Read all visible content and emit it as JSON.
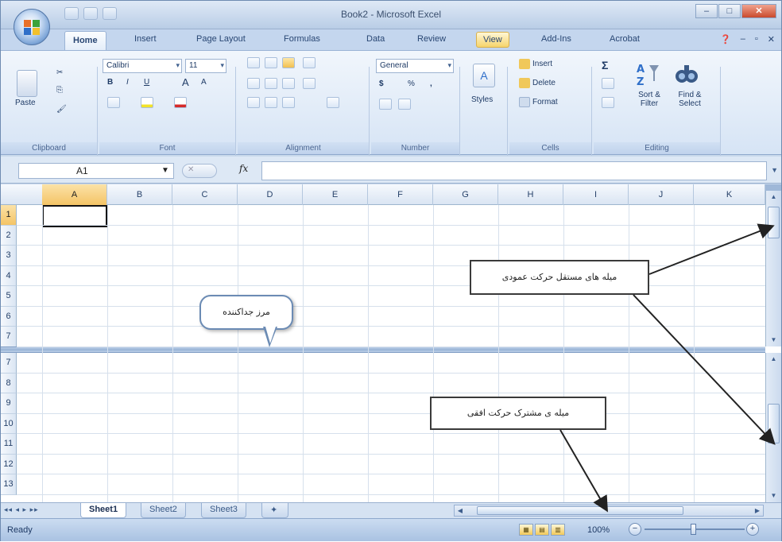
{
  "window": {
    "title": "Book2 - Microsoft Excel"
  },
  "ribbon_tabs": [
    "Home",
    "Insert",
    "Page Layout",
    "Formulas",
    "Data",
    "Review",
    "View",
    "Add-Ins",
    "Acrobat"
  ],
  "clipboard": {
    "paste_label": "Paste",
    "group_label": "Clipboard"
  },
  "font": {
    "name": "Calibri",
    "size": "11",
    "group_label": "Font",
    "bold": "B",
    "italic": "I",
    "underline": "U",
    "grow": "A",
    "shrink": "A"
  },
  "alignment": {
    "group_label": "Alignment"
  },
  "number": {
    "format": "General",
    "currency": "$",
    "percent": "%",
    "comma": ",",
    "group_label": "Number"
  },
  "styles": {
    "label": "Styles"
  },
  "cells": {
    "insert": "Insert",
    "delete": "Delete",
    "format": "Format",
    "group_label": "Cells"
  },
  "editing": {
    "sum": "Σ",
    "sort_filter": "Sort & Filter",
    "find_select": "Find & Select",
    "group_label": "Editing"
  },
  "formula_bar": {
    "name_box": "A1",
    "fx": "fx",
    "value": ""
  },
  "columns": [
    "A",
    "B",
    "C",
    "D",
    "E",
    "F",
    "G",
    "H",
    "I",
    "J",
    "K"
  ],
  "rows_top": [
    "1",
    "2",
    "3",
    "4",
    "5",
    "6",
    "7"
  ],
  "rows_bottom": [
    "7",
    "8",
    "9",
    "10",
    "11",
    "12",
    "13"
  ],
  "sheet_tabs": [
    "Sheet1",
    "Sheet2",
    "Sheet3"
  ],
  "status": {
    "ready": "Ready",
    "zoom": "100%"
  },
  "annotations": {
    "vertical_scrollbars": "میله های مستقل حرکت عمودی",
    "splitter": "مرز جداکننده",
    "horizontal_scrollbar": "میله ی مشترک حرکت افقی"
  }
}
